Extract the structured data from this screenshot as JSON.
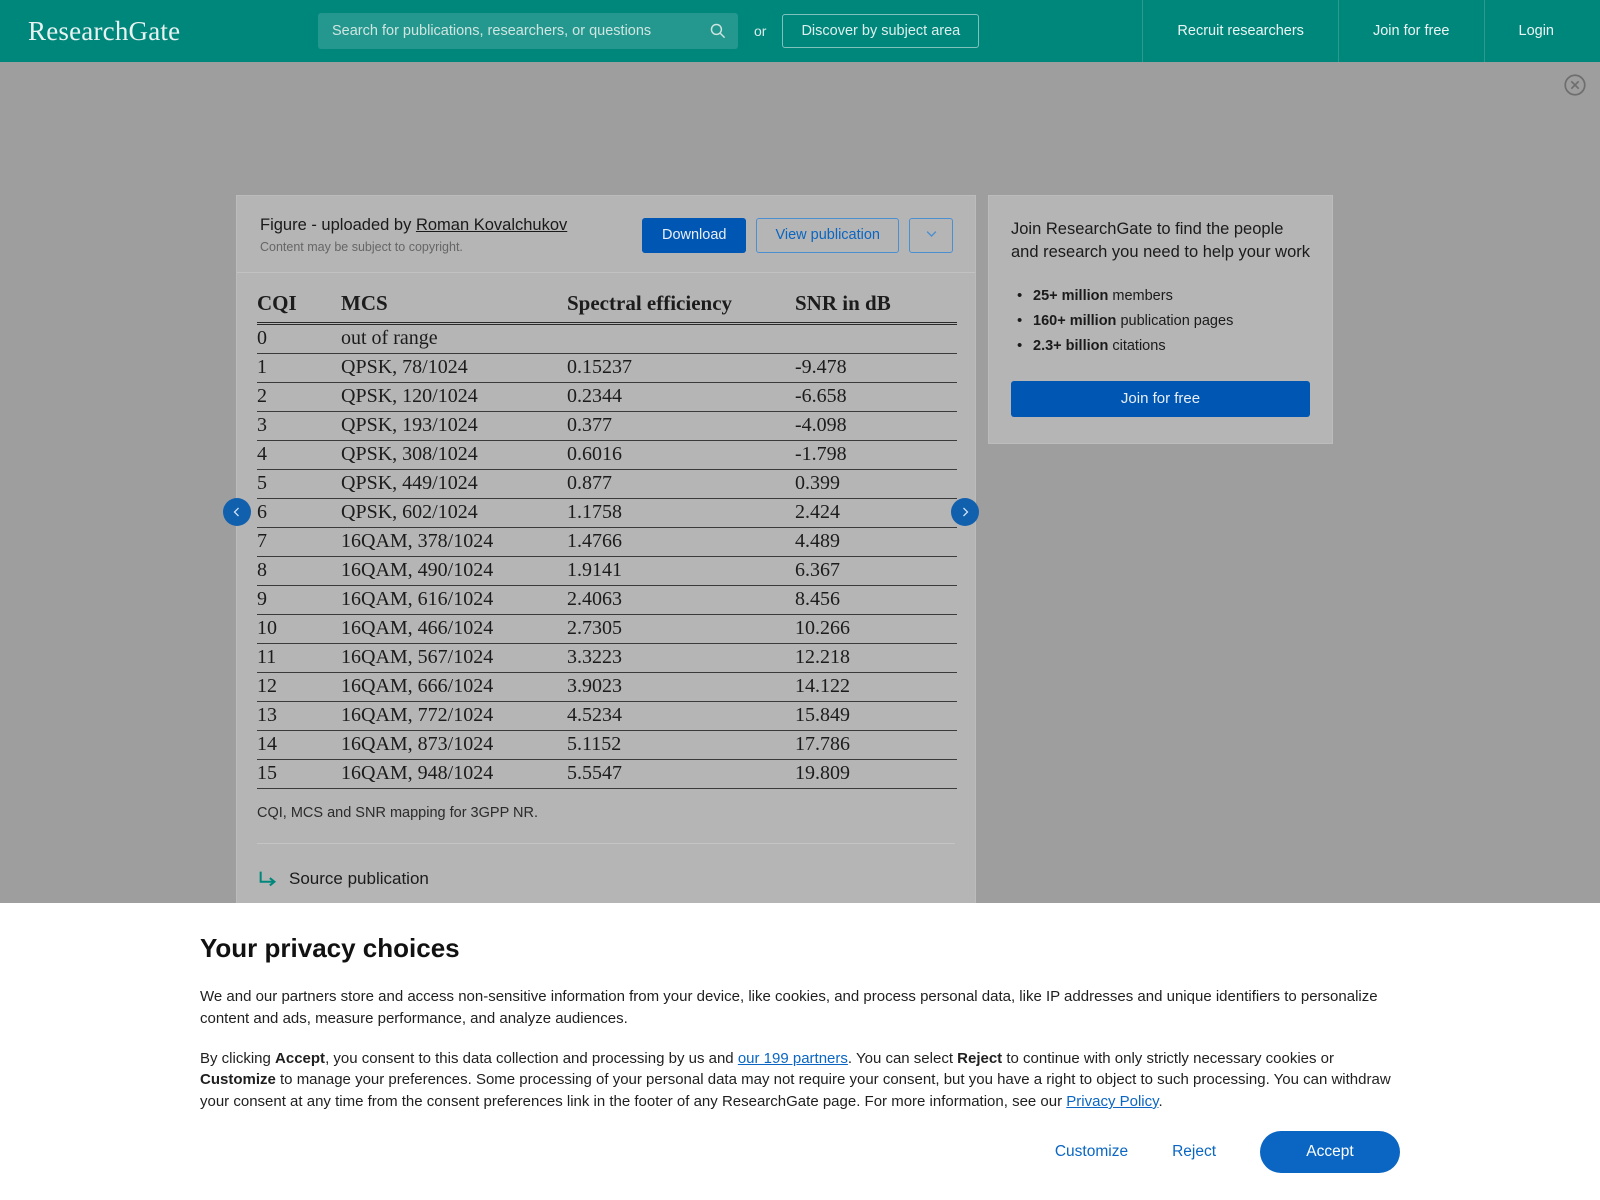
{
  "header": {
    "brand": "ResearchGate",
    "search_placeholder": "Search for publications, researchers, or questions",
    "search_value": "",
    "or_label": "or",
    "discover_label": "Discover by subject area",
    "recruit_label": "Recruit researchers",
    "join_label": "Join for free",
    "login_label": "Login",
    "bg_color": "#00877c"
  },
  "figure": {
    "title_prefix": "Figure - uploaded by ",
    "author": "Roman Kovalchukov",
    "copyright_note": "Content may be subject to copyright.",
    "download_label": "Download",
    "view_publication_label": "View publication",
    "more_icon": "chevron-down-icon",
    "caption": "CQI, MCS and SNR mapping for 3GPP NR.",
    "source_publication_label": "Source publication",
    "prev_icon": "chevron-left-icon",
    "next_icon": "chevron-right-icon",
    "accent_blue": "#0056b3"
  },
  "chart_data": {
    "type": "table",
    "title": "CQI, MCS and SNR mapping for 3GPP NR.",
    "columns": [
      "CQI",
      "MCS",
      "Spectral efficiency",
      "SNR in dB"
    ],
    "rows": [
      [
        "0",
        "out of range",
        "",
        ""
      ],
      [
        "1",
        "QPSK, 78/1024",
        "0.15237",
        "-9.478"
      ],
      [
        "2",
        "QPSK, 120/1024",
        "0.2344",
        "-6.658"
      ],
      [
        "3",
        "QPSK, 193/1024",
        "0.377",
        "-4.098"
      ],
      [
        "4",
        "QPSK, 308/1024",
        "0.6016",
        "-1.798"
      ],
      [
        "5",
        "QPSK, 449/1024",
        "0.877",
        "0.399"
      ],
      [
        "6",
        "QPSK, 602/1024",
        "1.1758",
        "2.424"
      ],
      [
        "7",
        "16QAM, 378/1024",
        "1.4766",
        "4.489"
      ],
      [
        "8",
        "16QAM, 490/1024",
        "1.9141",
        "6.367"
      ],
      [
        "9",
        "16QAM, 616/1024",
        "2.4063",
        "8.456"
      ],
      [
        "10",
        "16QAM, 466/1024",
        "2.7305",
        "10.266"
      ],
      [
        "11",
        "16QAM, 567/1024",
        "3.3223",
        "12.218"
      ],
      [
        "12",
        "16QAM, 666/1024",
        "3.9023",
        "14.122"
      ],
      [
        "13",
        "16QAM, 772/1024",
        "4.5234",
        "15.849"
      ],
      [
        "14",
        "16QAM, 873/1024",
        "5.1152",
        "17.786"
      ],
      [
        "15",
        "16QAM, 948/1024",
        "5.5547",
        "19.809"
      ]
    ]
  },
  "join_panel": {
    "title": "Join ResearchGate to find the people and research you need to help your work",
    "bullets": [
      {
        "strong": "25+ million",
        "rest": " members"
      },
      {
        "strong": "160+ million",
        "rest": " publication pages"
      },
      {
        "strong": "2.3+ billion",
        "rest": " citations"
      }
    ],
    "button_label": "Join for free"
  },
  "privacy": {
    "heading": "Your privacy choices",
    "paragraph1": "We and our partners store and access non-sensitive information from your device, like cookies, and process personal data, like IP addresses and unique identifiers to personalize content and ads, measure performance, and analyze audiences.",
    "p2_a": "By clicking ",
    "p2_b1": "Accept",
    "p2_c": ", you consent to this data collection and processing by us and ",
    "p2_link1": "our 199 partners",
    "p2_d": ". You can select ",
    "p2_b2": "Reject",
    "p2_e": " to continue with only strictly necessary cookies or ",
    "p2_b3": "Customize",
    "p2_f": " to manage your preferences. Some processing of your personal data may not require your consent, but you have a right to object to such processing. You can withdraw your consent at any time from the consent preferences link in the footer of any ResearchGate page. For more information, see our ",
    "p2_link2": "Privacy Policy",
    "p2_g": ".",
    "customize_label": "Customize",
    "reject_label": "Reject",
    "accept_label": "Accept",
    "accent": "#0a66c2"
  }
}
